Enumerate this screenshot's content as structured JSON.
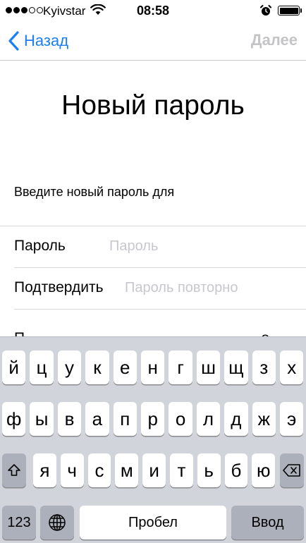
{
  "status_bar": {
    "carrier": "Kyivstar",
    "time": "08:58",
    "signal_bars_filled": 3,
    "signal_bars_total": 5,
    "battery_level": 1.0
  },
  "nav": {
    "back_label": "Назад",
    "next_label": "Далее"
  },
  "title": "Новый пароль",
  "instruction": "Введите новый пароль для",
  "form": {
    "password_label": "Пароль",
    "password_placeholder": "Пароль",
    "confirm_label": "Подтвердить",
    "confirm_placeholder": "Пароль повторно"
  },
  "partial_row": {
    "left_text": "П",
    "right_text": "о"
  },
  "keyboard": {
    "row1": [
      "й",
      "ц",
      "у",
      "к",
      "е",
      "н",
      "г",
      "ш",
      "щ",
      "з",
      "х"
    ],
    "row2": [
      "ф",
      "ы",
      "в",
      "а",
      "п",
      "р",
      "о",
      "л",
      "д",
      "ж",
      "э"
    ],
    "row3": [
      "я",
      "ч",
      "с",
      "м",
      "и",
      "т",
      "ь",
      "б",
      "ю"
    ],
    "numbers_label": "123",
    "space_label": "Пробел",
    "return_label": "Ввод"
  },
  "icons": {
    "wifi": "wifi-icon",
    "alarm": "alarm-clock-icon",
    "back": "chevron-left-icon",
    "shift": "shift-arrow-icon",
    "delete": "backspace-icon",
    "globe": "globe-icon"
  },
  "colors": {
    "accent": "#1a7ef6",
    "disabled": "#c4c4c7",
    "placeholder": "#c7c7cd",
    "keyboard_bg": "#d1d4db",
    "key_dark": "#abb0ba"
  }
}
